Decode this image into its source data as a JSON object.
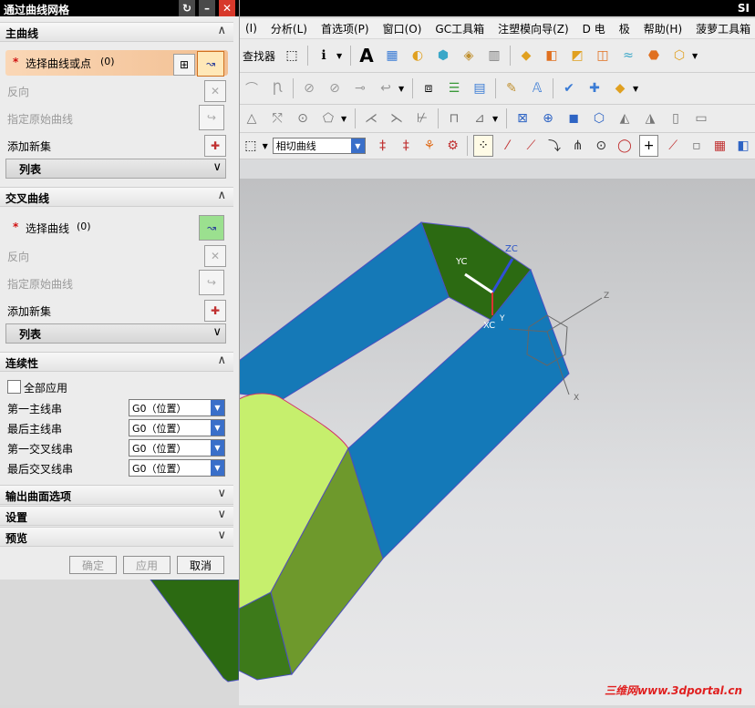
{
  "app": {
    "brand": "SI"
  },
  "menu": [
    "(I)",
    "分析(L)",
    "首选项(P)",
    "窗口(O)",
    "GC工具箱",
    "注塑模向导(Z)",
    "D 电",
    "极",
    "帮助(H)",
    "菠萝工具箱"
  ],
  "toolbar": {
    "finder_label": "查找器",
    "filter_value": "相切曲线"
  },
  "dialog": {
    "title": "通过曲线网格",
    "primary": {
      "header": "主曲线",
      "select_label": "选择曲线或点",
      "select_count": "(0)",
      "reverse": "反向",
      "specify_origin": "指定原始曲线",
      "add_new": "添加新集",
      "list": "列表"
    },
    "cross": {
      "header": "交叉曲线",
      "select_label": "选择曲线",
      "select_count": "(0)",
      "reverse": "反向",
      "specify_origin": "指定原始曲线",
      "add_new": "添加新集",
      "list": "列表"
    },
    "continuity": {
      "header": "连续性",
      "apply_all": "全部应用",
      "rows": [
        {
          "label": "第一主线串",
          "value": "G0（位置）"
        },
        {
          "label": "最后主线串",
          "value": "G0（位置）"
        },
        {
          "label": "第一交叉线串",
          "value": "G0（位置）"
        },
        {
          "label": "最后交叉线串",
          "value": "G0（位置）"
        }
      ]
    },
    "output_options": "输出曲面选项",
    "settings": "设置",
    "preview": "预览",
    "buttons": {
      "ok": "确定",
      "apply": "应用",
      "cancel": "取消"
    }
  },
  "viewport": {
    "axes": {
      "zc": "ZC",
      "yc": "YC",
      "xc": "XC",
      "y": "Y",
      "z": "Z",
      "x": "X"
    }
  },
  "watermark": "三维网www.3dportal.cn",
  "colors": {
    "face_blue": "#1479b8",
    "face_dark_green": "#2d6b14",
    "face_olive": "#6f9a2c",
    "face_light_green": "#c8f270",
    "accent_orange": "#f0b070"
  }
}
